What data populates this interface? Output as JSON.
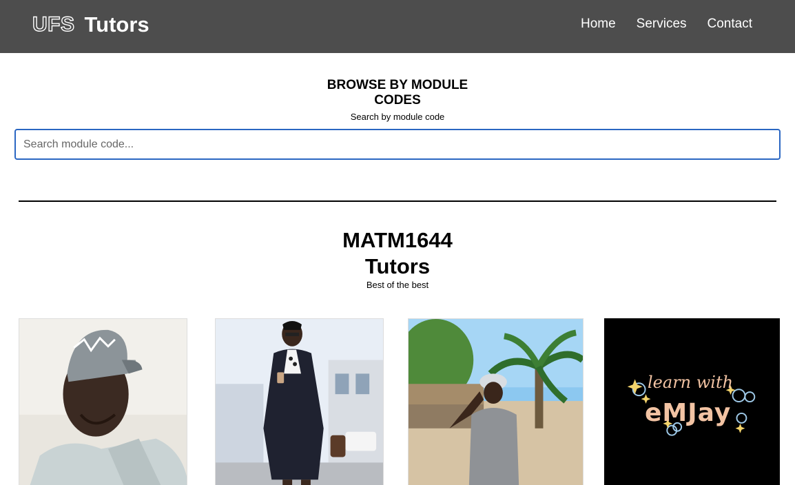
{
  "header": {
    "brand_outline": "UFS",
    "brand_solid": "Tutors",
    "nav": [
      "Home",
      "Services",
      "Contact"
    ]
  },
  "browse": {
    "title_line1": "BROWSE BY MODULE",
    "title_line2": "CODES",
    "subtitle": "Search by module code",
    "search_placeholder": "Search module code..."
  },
  "module": {
    "title_line1": "MATM1644",
    "title_line2": "Tutors",
    "subtitle": "Best of the best"
  },
  "tutors": [
    {
      "image": "tutor-photo-cap-selfie"
    },
    {
      "image": "tutor-photo-coat-street"
    },
    {
      "image": "tutor-photo-palm-tree"
    },
    {
      "image": "learn-with-emjay-logo",
      "logo_line1": "learn with",
      "logo_line2": "eMJay"
    }
  ],
  "colors": {
    "navbar_bg": "#4d4d4d",
    "search_border": "#2a66c2",
    "logo_text": "#f2c3a3"
  }
}
